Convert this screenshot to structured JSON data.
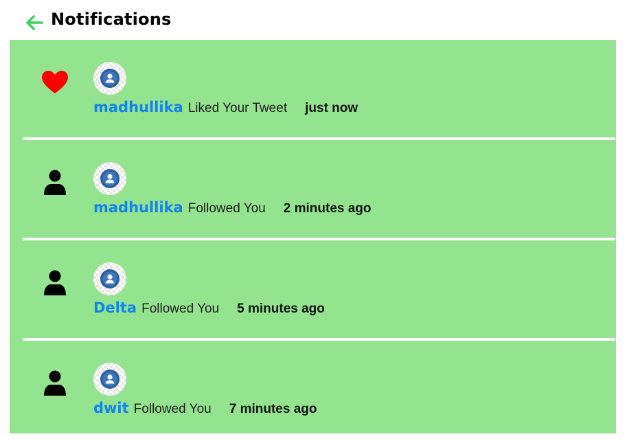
{
  "header": {
    "title": "Notifications",
    "back_icon": "arrow-left-icon",
    "accent_color": "#3ecf5a"
  },
  "colors": {
    "background": "#94e48f",
    "username": "#1183ee",
    "heart": "#ff0000",
    "divider": "#ffffff"
  },
  "notifications": [
    {
      "type": "like",
      "icon": "heart-icon",
      "user": "madhullika",
      "action": "Liked Your Tweet",
      "time": "just now"
    },
    {
      "type": "follow",
      "icon": "person-icon",
      "user": "madhullika",
      "action": "Followed You",
      "time": "2 minutes ago"
    },
    {
      "type": "follow",
      "icon": "person-icon",
      "user": "Delta",
      "action": "Followed You",
      "time": "5 minutes ago"
    },
    {
      "type": "follow",
      "icon": "person-icon",
      "user": "dwit",
      "action": "Followed You",
      "time": "7 minutes ago"
    }
  ]
}
